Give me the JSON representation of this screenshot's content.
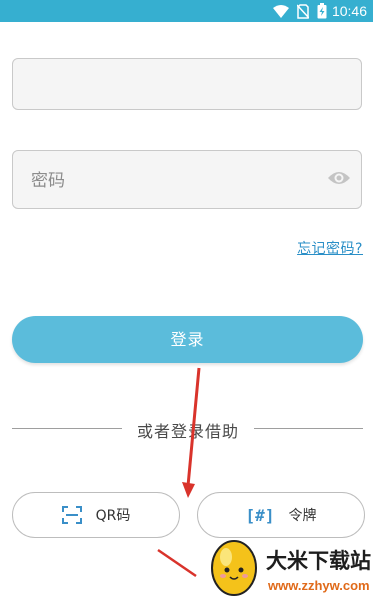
{
  "status_bar": {
    "time": "10:46",
    "icons": [
      "wifi-icon",
      "no-sim-icon",
      "battery-charging-icon"
    ]
  },
  "login_form": {
    "password_placeholder": "密码",
    "forgot_password": "忘记密码?",
    "login_button": "登录"
  },
  "alternatives": {
    "divider_text": "或者登录借助",
    "qr_label": "QR码",
    "token_icon_text": "[#]",
    "token_label": "令牌"
  },
  "watermark": {
    "title": "大米下载站",
    "url": "www.zzhyw.com"
  },
  "colors": {
    "status_bar": "#36afd0",
    "login_button": "#5bbcdb",
    "link": "#2a8fc7",
    "annotation_arrow": "#d9332b"
  }
}
